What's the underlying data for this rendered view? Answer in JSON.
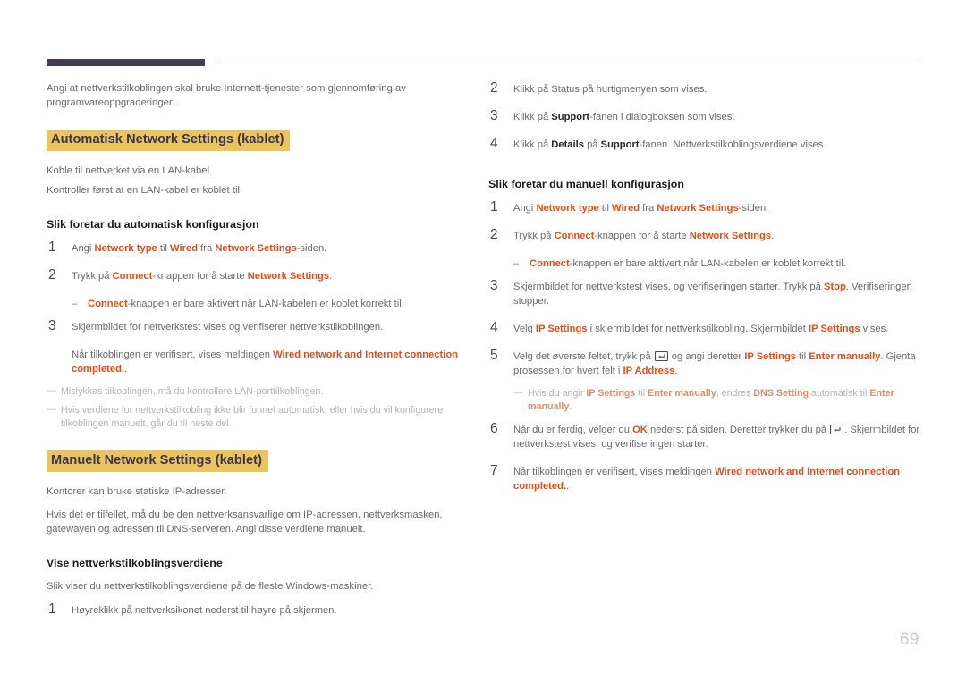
{
  "page": {
    "number": "69",
    "header_rule": {
      "dark_color": "#453b52",
      "line_color": "#8c8c8c"
    },
    "accent_colors": {
      "highlight": "#e9c45f",
      "heading_text": "#3d3550",
      "orange": "#e04e18",
      "body": "#6b6b6b",
      "note": "#b3b3b3"
    }
  },
  "left": {
    "intro": "Angi at nettverkstilkoblingen skal bruke Internett-tjenester som gjennomføring av programvareoppgraderinger.",
    "section_auto": "Automatisk Network Settings (kablet)",
    "auto_line1": "Koble til nettverket via en LAN-kabel.",
    "auto_line2": "Kontroller først at en LAN-kabel er koblet til.",
    "subhead_auto": "Slik foretar du automatisk konfigurasjon",
    "step1": {
      "num": "1",
      "p1": "Angi ",
      "b1": "Network type",
      "p2": " til ",
      "b2": "Wired",
      "p3": " fra ",
      "b3": "Network Settings",
      "p4": "-siden."
    },
    "step2": {
      "num": "2",
      "p1": "Trykk på ",
      "b1": "Connect",
      "p2": "-knappen for å starte ",
      "b2": "Network Settings",
      "p3": "."
    },
    "step2_dash": {
      "dash": "–",
      "b1": "Connect",
      "p1": "-knappen er bare aktivert når LAN-kabelen er koblet korrekt til."
    },
    "step3": {
      "num": "3",
      "p1": "Skjermbildet for nettverkstest vises og verifiserer nettverkstilkoblingen."
    },
    "step3_extra": {
      "p1": "Når tilkoblingen er verifisert, vises meldingen ",
      "b1": "Wired network and Internet connection completed.",
      "p2": "."
    },
    "note1": "Mislykkes tilkoblingen, må du kontrollere LAN-porttilkoblingen.",
    "note2": "Hvis verdiene for nettverkstilkobling ikke blir funnet automatisk, eller hvis du vil konfigurere tilkoblingen manuelt, går du til neste del.",
    "section_manual": "Manuelt Network Settings (kablet)",
    "manual_line1": "Kontorer kan bruke statiske IP-adresser.",
    "manual_line2": "Hvis det er tilfellet, må du be den nettverksansvarlige om IP-adressen, nettverksmasken, gatewayen og adressen til DNS-serveren. Angi disse verdiene manuelt.",
    "subhead_view": "Vise nettverkstilkoblingsverdiene",
    "view_line1": "Slik viser du nettverkstilkoblingsverdiene på de fleste Windows-maskiner.",
    "view_step1": {
      "num": "1",
      "p1": "Høyreklikk på nettverksikonet nederst til høyre på skjermen."
    }
  },
  "right": {
    "view_step2": {
      "num": "2",
      "p1": "Klikk på Status på hurtigmenyen som vises."
    },
    "view_step3": {
      "num": "3",
      "p1": "Klikk på ",
      "b1": "Support",
      "p2": "-fanen i dialogboksen som vises."
    },
    "view_step4": {
      "num": "4",
      "p1": "Klikk på ",
      "b1": "Details",
      "p2": " på ",
      "b2": "Support",
      "p3": "-fanen. Nettverkstilkoblingsverdiene vises."
    },
    "subhead_manual": "Slik foretar du manuell konfigurasjon",
    "step1": {
      "num": "1",
      "p1": "Angi ",
      "b1": "Network type",
      "p2": " til ",
      "b2": "Wired",
      "p3": " fra ",
      "b3": "Network Settings",
      "p4": "-siden."
    },
    "step2": {
      "num": "2",
      "p1": "Trykk på ",
      "b1": "Connect",
      "p2": "-knappen for å starte ",
      "b2": "Network Settings",
      "p3": "."
    },
    "step2_dash": {
      "dash": "–",
      "b1": "Connect",
      "p1": "-knappen er bare aktivert når LAN-kabelen er koblet korrekt til."
    },
    "step3": {
      "num": "3",
      "p1": "Skjermbildet for nettverkstest vises, og verifiseringen starter. Trykk på ",
      "b1": "Stop",
      "p2": ". Verifiseringen stopper."
    },
    "step4": {
      "num": "4",
      "p1": "Velg ",
      "b1": "IP Settings",
      "p2": " i skjermbildet for nettverkstilkobling. Skjermbildet ",
      "b2": "IP Settings",
      "p3": " vises."
    },
    "step5": {
      "num": "5",
      "p1": "Velg det øverste feltet, trykk på ",
      "icon": "enter-key-icon",
      "p2": " og angi deretter ",
      "b1": "IP Settings",
      "p3": " til ",
      "b2": "Enter manually",
      "p4": ". Gjenta prosessen for hvert felt i ",
      "b3": "IP Address",
      "p5": "."
    },
    "step5_note": {
      "p1": "Hvis du angir ",
      "b1": "IP Settings",
      "p2": " til ",
      "b2": "Enter manually",
      "p3": ", endres ",
      "b3": "DNS Setting",
      "p4": " automatisk til ",
      "b4": "Enter manually",
      "p5": "."
    },
    "step6": {
      "num": "6",
      "p1": "Når du er ferdig, velger du ",
      "b1": "OK",
      "p2": " nederst på siden. Deretter trykker du på ",
      "icon": "enter-key-icon",
      "p3": ". Skjermbildet for nettverkstest vises, og verifiseringen starter."
    },
    "step7": {
      "num": "7",
      "p1": "Når tilkoblingen er verifisert, vises meldingen ",
      "b1": "Wired network and Internet connection completed.",
      "p2": "."
    }
  }
}
